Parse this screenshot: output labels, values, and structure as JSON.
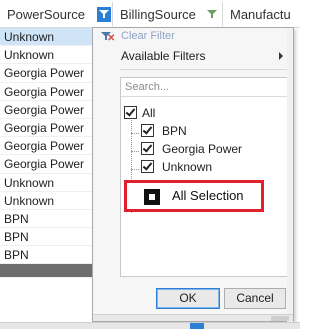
{
  "grid": {
    "columns": [
      {
        "label": "PowerSource",
        "filter_active": true
      },
      {
        "label": "BillingSource",
        "filter_active": false
      },
      {
        "label": "Manufactu"
      }
    ],
    "rows": [
      {
        "value": "Unknown",
        "selected": true
      },
      {
        "value": "Unknown"
      },
      {
        "value": "Georgia Power"
      },
      {
        "value": "Georgia Power"
      },
      {
        "value": "Georgia Power"
      },
      {
        "value": "Georgia Power"
      },
      {
        "value": "Georgia Power"
      },
      {
        "value": "Georgia Power"
      },
      {
        "value": "Unknown"
      },
      {
        "value": "Unknown"
      },
      {
        "value": "BPN"
      },
      {
        "value": "BPN"
      },
      {
        "value": "BPN"
      }
    ]
  },
  "filter_popup": {
    "clear_filter_label": "Clear Filter",
    "available_filters_label": "Available Filters",
    "search_placeholder": "Search...",
    "all_label": "All",
    "all_checked": true,
    "items": [
      {
        "label": "BPN",
        "checked": true
      },
      {
        "label": "Georgia Power",
        "checked": true
      },
      {
        "label": "Unknown",
        "checked": true
      }
    ],
    "ok_label": "OK",
    "cancel_label": "Cancel"
  },
  "annotation": {
    "label": "All Selection",
    "color": "#e0202a"
  },
  "colors": {
    "selection": "#cfe5f7",
    "active_filter": "#2b7fd4",
    "inactive_filter": "#6e9f60"
  },
  "icons": [
    "filter-funnel-icon",
    "clear-filter-icon",
    "submenu-arrow-icon",
    "checkbox-icon"
  ]
}
